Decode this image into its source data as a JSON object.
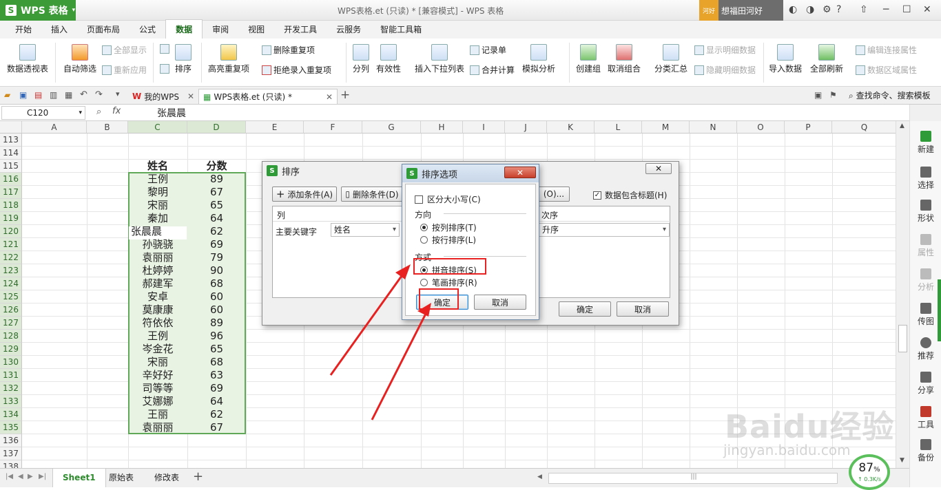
{
  "app": {
    "wps_label": "WPS 表格",
    "window_title": "WPS表格.et (只读) * [兼容模式] - WPS 表格",
    "user_badge": "河好",
    "user_name": "想福田河好"
  },
  "menu_tabs": [
    "开始",
    "插入",
    "页面布局",
    "公式",
    "数据",
    "审阅",
    "视图",
    "开发工具",
    "云服务",
    "智能工具箱"
  ],
  "ribbon": {
    "pivot": "数据透视表",
    "autofilter": "自动筛选",
    "show_all": "全部显示",
    "reapply": "重新应用",
    "sort": "排序",
    "highlight_dup": "高亮重复项",
    "remove_dup": "删除重复项",
    "reject_dup": "拒绝录入重复项",
    "split": "分列",
    "validity": "有效性",
    "insert_dropdown": "插入下拉列表",
    "record": "记录单",
    "consolidate": "合并计算",
    "simulate": "模拟分析",
    "create_group": "创建组",
    "ungroup": "取消组合",
    "subtotal": "分类汇总",
    "show_detail": "显示明细数据",
    "hide_detail": "隐藏明细数据",
    "import_data": "导入数据",
    "refresh_all": "全部刷新",
    "edit_conn": "编辑连接属性",
    "range_props": "数据区域属性"
  },
  "doc_tabs": {
    "mywps": "我的WPS",
    "file": "WPS表格.et (只读) *",
    "search": "查找命令、搜索模板"
  },
  "formula_bar": {
    "cell_ref": "C120",
    "fx": "fx",
    "value": "张晨晨"
  },
  "columns": [
    "A",
    "B",
    "C",
    "D",
    "E",
    "F",
    "G",
    "H",
    "I",
    "J",
    "K",
    "L",
    "M",
    "N",
    "O",
    "P",
    "Q"
  ],
  "rows": [
    "113",
    "114",
    "115",
    "116",
    "117",
    "118",
    "119",
    "120",
    "121",
    "122",
    "123",
    "124",
    "125",
    "126",
    "127",
    "128",
    "129",
    "130",
    "131",
    "132",
    "133",
    "134",
    "135",
    "136",
    "137",
    "138"
  ],
  "table": {
    "header_name": "姓名",
    "header_score": "分数",
    "names": [
      "王例",
      "黎明",
      "宋丽",
      "秦加",
      "张晨晨",
      "孙骁骁",
      "袁丽丽",
      "杜婷婷",
      "郝建军",
      "安卓",
      "莫康康",
      "符依依",
      "王例",
      "岑金花",
      "宋丽",
      "辛好好",
      "司等等",
      "艾娜娜",
      "王丽",
      "袁丽丽"
    ],
    "scores": [
      "89",
      "67",
      "65",
      "64",
      "62",
      "69",
      "79",
      "90",
      "68",
      "60",
      "60",
      "89",
      "96",
      "65",
      "68",
      "63",
      "69",
      "64",
      "62",
      "67"
    ]
  },
  "sort_dialog": {
    "title": "排序",
    "add_condition": "添加条件(A)",
    "delete_condition": "删除条件(D)",
    "options_btn": "(O)...",
    "has_header_label": "数据包含标题(H)",
    "col_header": "列",
    "order_header": "次序",
    "primary_key_label": "主要关键字",
    "primary_key_value": "姓名",
    "order_value": "升序",
    "ok": "确定",
    "cancel": "取消"
  },
  "options_dialog": {
    "title": "排序选项",
    "case_sensitive": "区分大小写(C)",
    "direction_label": "方向",
    "by_column": "按列排序(T)",
    "by_row": "按行排序(L)",
    "method_label": "方式",
    "pinyin": "拼音排序(S)",
    "stroke": "笔画排序(R)",
    "ok": "确定",
    "cancel": "取消"
  },
  "right_panel": [
    "新建",
    "选择",
    "形状",
    "属性",
    "分析",
    "传图",
    "推荐",
    "分享",
    "工具",
    "备份"
  ],
  "sheets": [
    "Sheet1",
    "原始表",
    "修改表"
  ],
  "speed": {
    "percent": "87",
    "unit": "%",
    "rate": "0.3K/s"
  },
  "watermark": {
    "brand": "Baidu经验",
    "url": "jingyan.baidu.com"
  },
  "colors": {
    "accent": "#3c9b36",
    "selection": "#e8f3e3",
    "highlight": "#e82020"
  }
}
